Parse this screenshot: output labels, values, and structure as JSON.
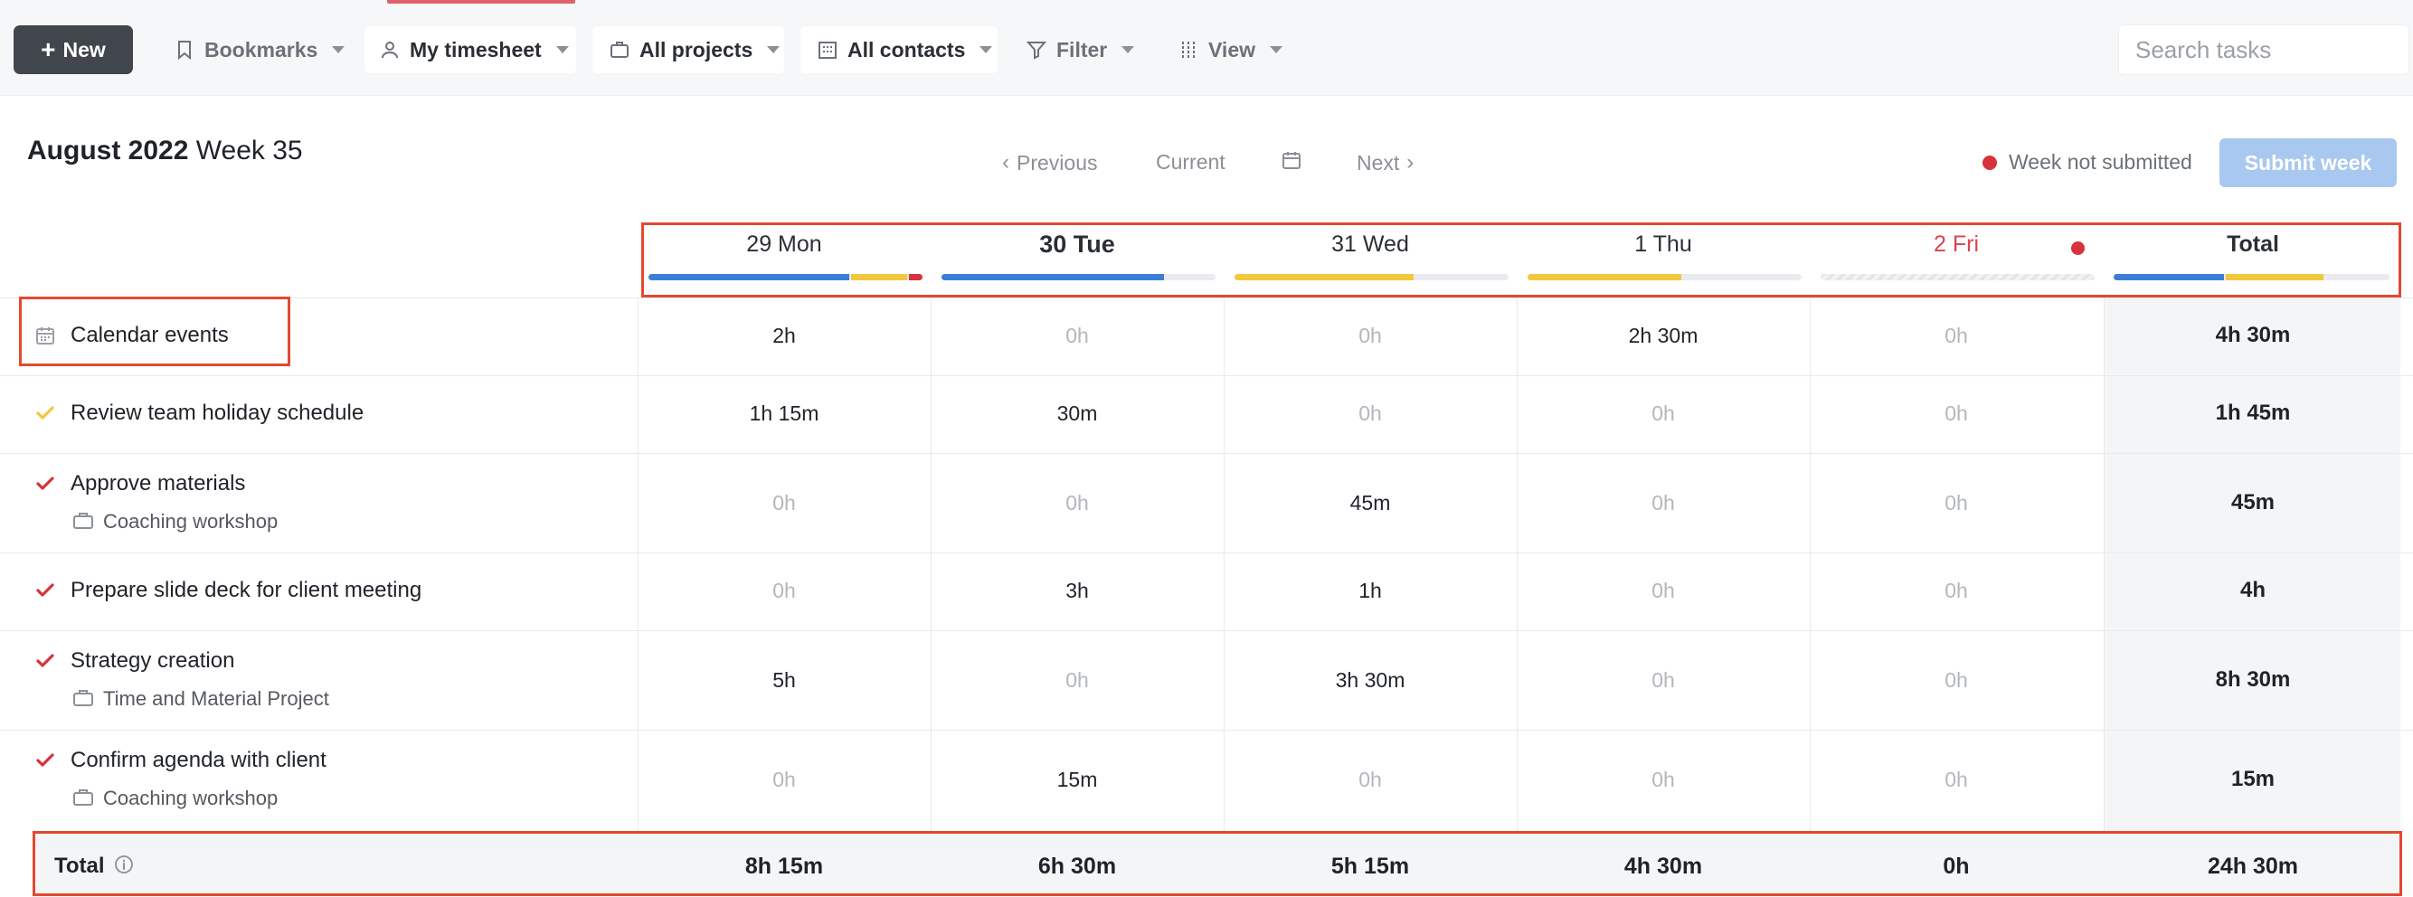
{
  "toolbar": {
    "new_label": "New",
    "bookmarks_label": "Bookmarks",
    "timesheet_label": "My timesheet",
    "projects_label": "All projects",
    "contacts_label": "All contacts",
    "filter_label": "Filter",
    "view_label": "View",
    "search_placeholder": "Search tasks"
  },
  "header": {
    "month": "August 2022",
    "week": "Week 35",
    "previous_label": "Previous",
    "current_label": "Current",
    "next_label": "Next",
    "status_label": "Week not submitted",
    "submit_label": "Submit week"
  },
  "days": [
    {
      "label": "29 Mon"
    },
    {
      "label": "30 Tue"
    },
    {
      "label": "31 Wed"
    },
    {
      "label": "1 Thu"
    },
    {
      "label": "2 Fri"
    }
  ],
  "total_header": "Total",
  "tasks": [
    {
      "name": "Calendar events",
      "project": "",
      "hours": [
        "2h",
        "0h",
        "0h",
        "2h 30m",
        "0h"
      ],
      "total": "4h 30m"
    },
    {
      "name": "Review team holiday schedule",
      "project": "",
      "hours": [
        "1h 15m",
        "30m",
        "0h",
        "0h",
        "0h"
      ],
      "total": "1h 45m"
    },
    {
      "name": "Approve materials",
      "project": "Coaching workshop",
      "hours": [
        "0h",
        "0h",
        "45m",
        "0h",
        "0h"
      ],
      "total": "45m"
    },
    {
      "name": "Prepare slide deck for client meeting",
      "project": "",
      "hours": [
        "0h",
        "3h",
        "1h",
        "0h",
        "0h"
      ],
      "total": "4h"
    },
    {
      "name": "Strategy creation",
      "project": "Time and Material Project",
      "hours": [
        "5h",
        "0h",
        "3h 30m",
        "0h",
        "0h"
      ],
      "total": "8h 30m"
    },
    {
      "name": "Confirm agenda with client",
      "project": "Coaching workshop",
      "hours": [
        "0h",
        "15m",
        "0h",
        "0h",
        "0h"
      ],
      "total": "15m"
    }
  ],
  "totals": {
    "label": "Total",
    "values": [
      "8h 15m",
      "6h 30m",
      "5h 15m",
      "4h 30m",
      "0h"
    ],
    "grand": "24h 30m"
  },
  "colors": {
    "blue": "#3b7dd8",
    "yellow": "#f2c83a",
    "red": "#d8323c",
    "submit_disabled": "#a9c8ef"
  }
}
